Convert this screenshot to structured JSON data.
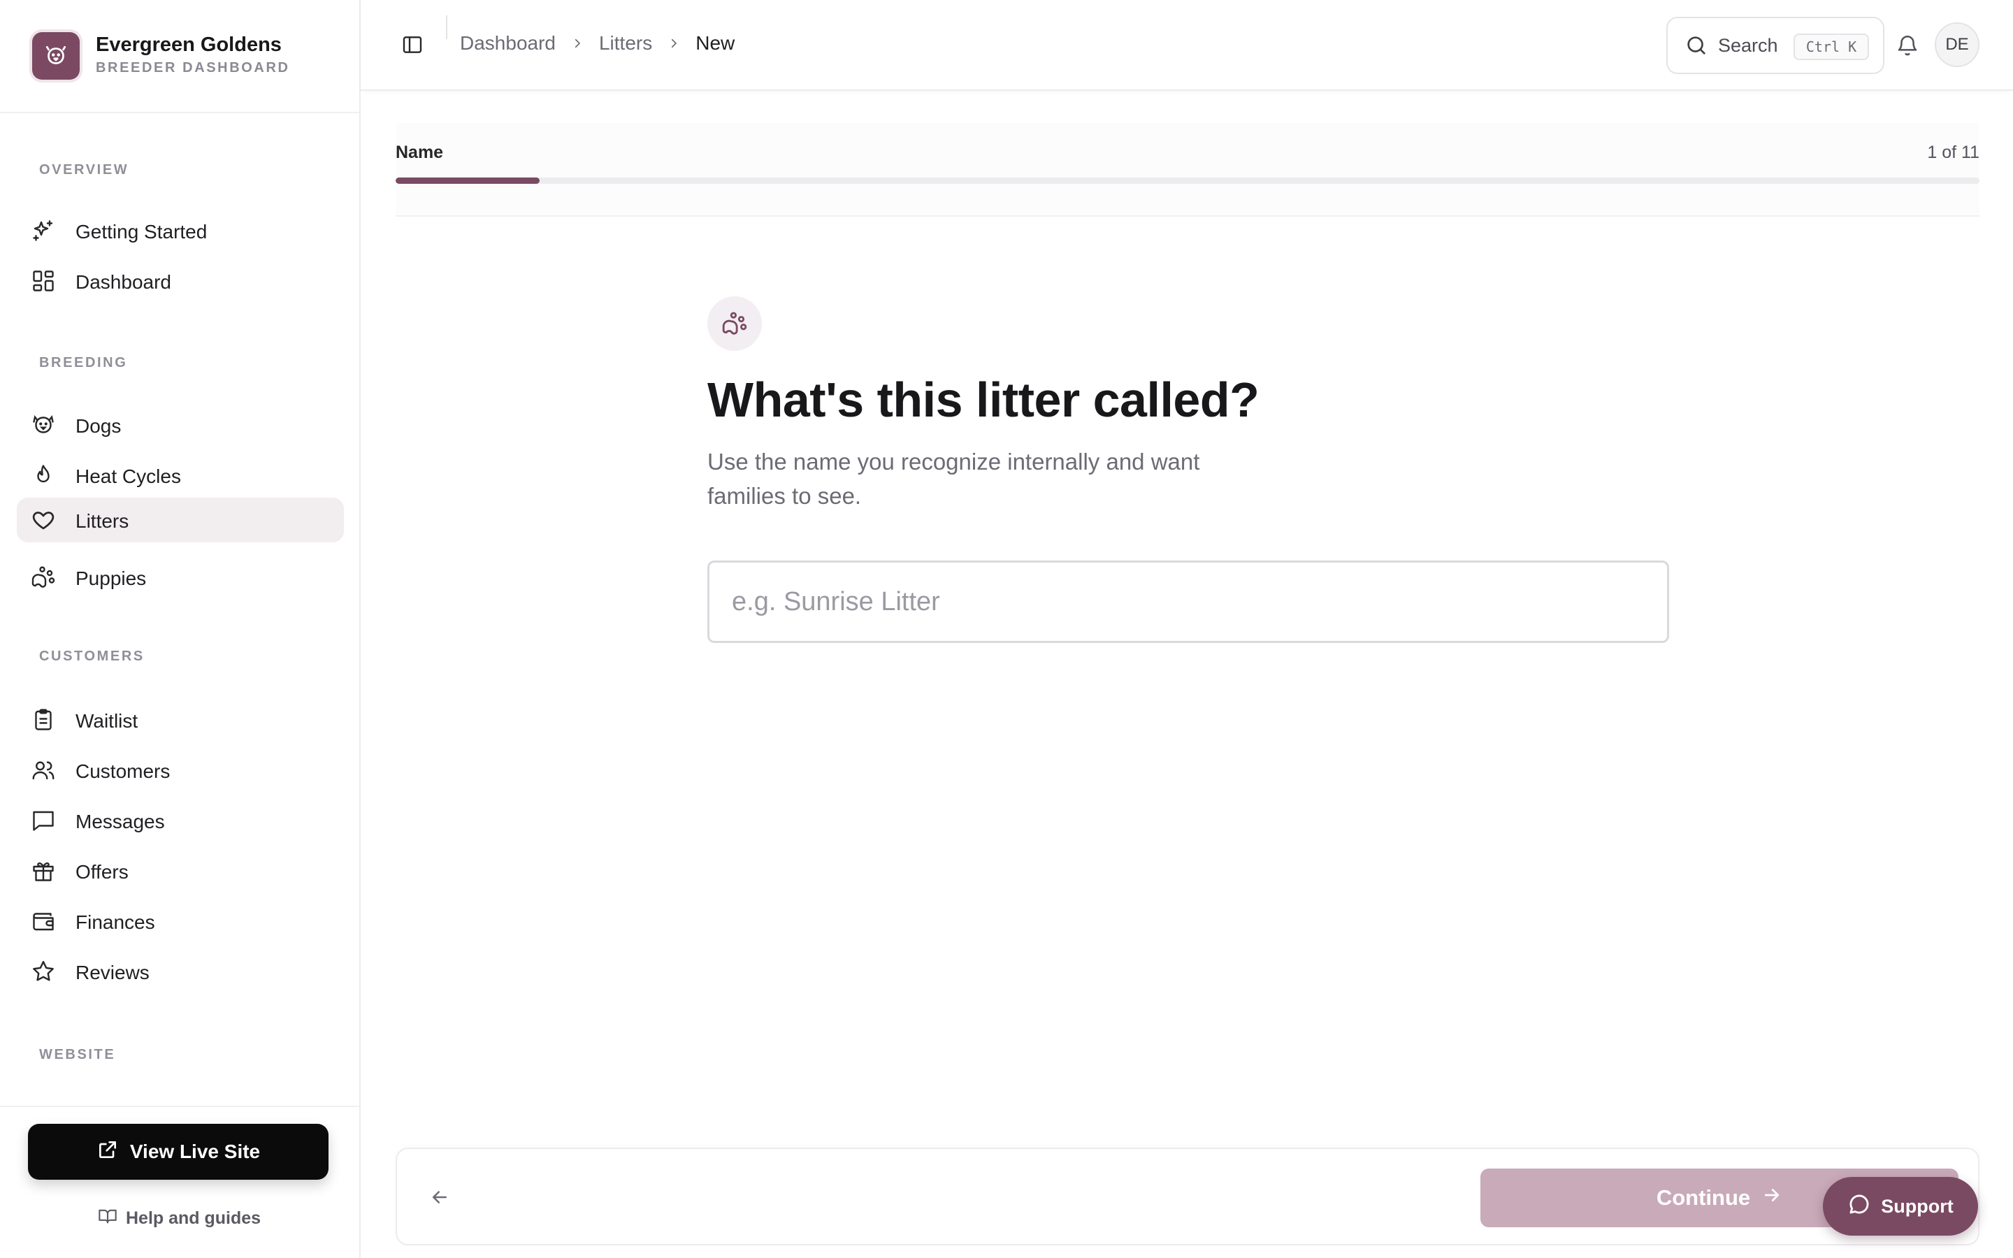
{
  "brand": {
    "name": "Evergreen Goldens",
    "subtitle": "BREEDER DASHBOARD"
  },
  "sidebar": {
    "sections": [
      {
        "title": "OVERVIEW"
      },
      {
        "title": "BREEDING"
      },
      {
        "title": "CUSTOMERS"
      },
      {
        "title": "WEBSITE"
      }
    ],
    "items": [
      {
        "label": "Getting Started",
        "icon": "sparkles-icon"
      },
      {
        "label": "Dashboard",
        "icon": "dashboard-grid-icon"
      },
      {
        "label": "Dogs",
        "icon": "dog-icon"
      },
      {
        "label": "Heat Cycles",
        "icon": "flame-icon"
      },
      {
        "label": "Litters",
        "icon": "heart-icon",
        "active": true
      },
      {
        "label": "Puppies",
        "icon": "paw-icon"
      },
      {
        "label": "Waitlist",
        "icon": "clipboard-icon"
      },
      {
        "label": "Customers",
        "icon": "users-icon"
      },
      {
        "label": "Messages",
        "icon": "message-square-icon"
      },
      {
        "label": "Offers",
        "icon": "gift-icon"
      },
      {
        "label": "Finances",
        "icon": "wallet-icon"
      },
      {
        "label": "Reviews",
        "icon": "star-icon"
      }
    ],
    "live_site_label": "View Live Site",
    "help_label": "Help and guides"
  },
  "header": {
    "breadcrumbs": [
      "Dashboard",
      "Litters",
      "New"
    ],
    "search_label": "Search",
    "search_shortcut": "Ctrl K",
    "avatar_initials": "DE"
  },
  "wizard": {
    "step_name": "Name",
    "step_count": "1 of 11",
    "progress_fraction": 0.0909,
    "question": "What's this litter called?",
    "help_text": "Use the name you recognize internally and want families to see.",
    "input_value": "",
    "input_placeholder": "e.g. Sunrise Litter",
    "continue_label": "Continue"
  },
  "support_label": "Support",
  "colors": {
    "accent": "#7a4a62",
    "accent_disabled": "#c9aab9",
    "active_bg": "#f2eef0"
  }
}
